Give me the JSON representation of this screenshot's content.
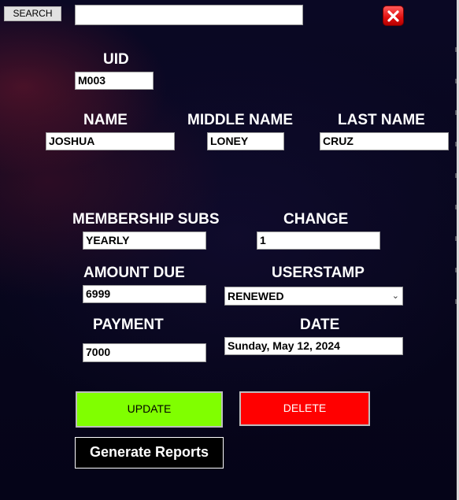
{
  "search": {
    "button_label": "SEARCH",
    "value": ""
  },
  "form": {
    "uid": {
      "label": "UID",
      "value": "M003"
    },
    "name": {
      "label": "NAME",
      "value": "JOSHUA"
    },
    "middle_name": {
      "label": "MIDDLE NAME",
      "value": "LONEY"
    },
    "last_name": {
      "label": "LAST NAME",
      "value": "CRUZ"
    },
    "membership": {
      "label": "MEMBERSHIP SUBS",
      "value": "YEARLY"
    },
    "change": {
      "label": "CHANGE",
      "value": "1"
    },
    "amount_due": {
      "label": "AMOUNT DUE",
      "value": "6999"
    },
    "userstamp": {
      "label": "USERSTAMP",
      "value": "RENEWED"
    },
    "payment": {
      "label": "PAYMENT",
      "value": "7000"
    },
    "date": {
      "label": "DATE",
      "value": "Sunday, May 12, 2024"
    }
  },
  "actions": {
    "update": "UPDATE",
    "delete": "DELETE",
    "generate_reports": "Generate Reports"
  },
  "icons": {
    "close": "close-icon",
    "dropdown": "chevron-down-icon"
  },
  "colors": {
    "update": "#80ff00",
    "delete": "#ff0000",
    "close": "#e01010",
    "background": "#07061f"
  }
}
